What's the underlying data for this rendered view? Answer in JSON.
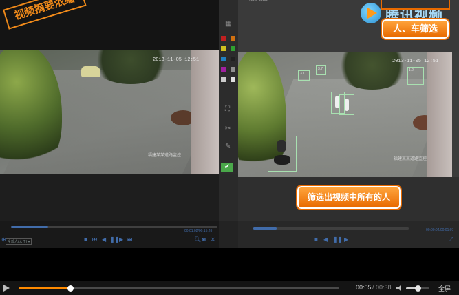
{
  "overlay": {
    "title_stamp": "视频摘要浓缩",
    "brand": "腾讯视频",
    "filter_button": "人、车筛选",
    "callout": "筛选出视频中所有的人"
  },
  "left_video": {
    "timestamp": "2013-11-05  12:51",
    "watermark": "福建某某道路监控"
  },
  "right_video": {
    "timestamp": "2013-11-05  12:51",
    "watermark": "福建某某道路监控",
    "top_text": "▪▪▪▪▪  ▪▪▪▪▪",
    "detections": [
      "3.1",
      "3.7",
      "1.2"
    ]
  },
  "embedded": {
    "left_time": "00:01:02/00:15:26",
    "right_time": "00:00:04/00:01:07",
    "right_select": "全部人(大于) ▾",
    "left_progress": 0.18,
    "right_progress": 0.15
  },
  "player": {
    "current_time": "00:05",
    "separator": "/",
    "total_time": "00:38",
    "fullscreen": "全屏",
    "progress": 0.16,
    "volume": 0.5
  },
  "colors": {
    "accent": "#ff8a00",
    "mini_accent": "#4d7fc8",
    "detection_box": "#a8e0b0"
  },
  "icons": {
    "play": "play-icon",
    "volume": "volume-icon",
    "brand": "tencent-video-logo-icon"
  }
}
